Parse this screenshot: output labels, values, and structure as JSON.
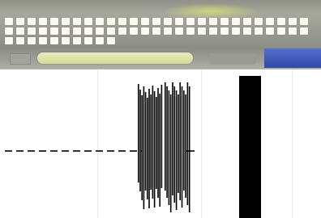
{
  "window": {
    "title": ""
  },
  "colors": {
    "toolbar_bg": "#9c9d93",
    "highlight": "#d6dd90",
    "active_tab": "#2f47a8",
    "waveform": "#000000"
  },
  "toolbar": {
    "key_count": 64
  },
  "tabs": [
    {
      "label": "",
      "state": "highlighted"
    },
    {
      "label": "",
      "state": "inactive"
    },
    {
      "label": "",
      "state": "active"
    }
  ],
  "canvas": {
    "content": "waveform",
    "baseline": "dashed"
  }
}
